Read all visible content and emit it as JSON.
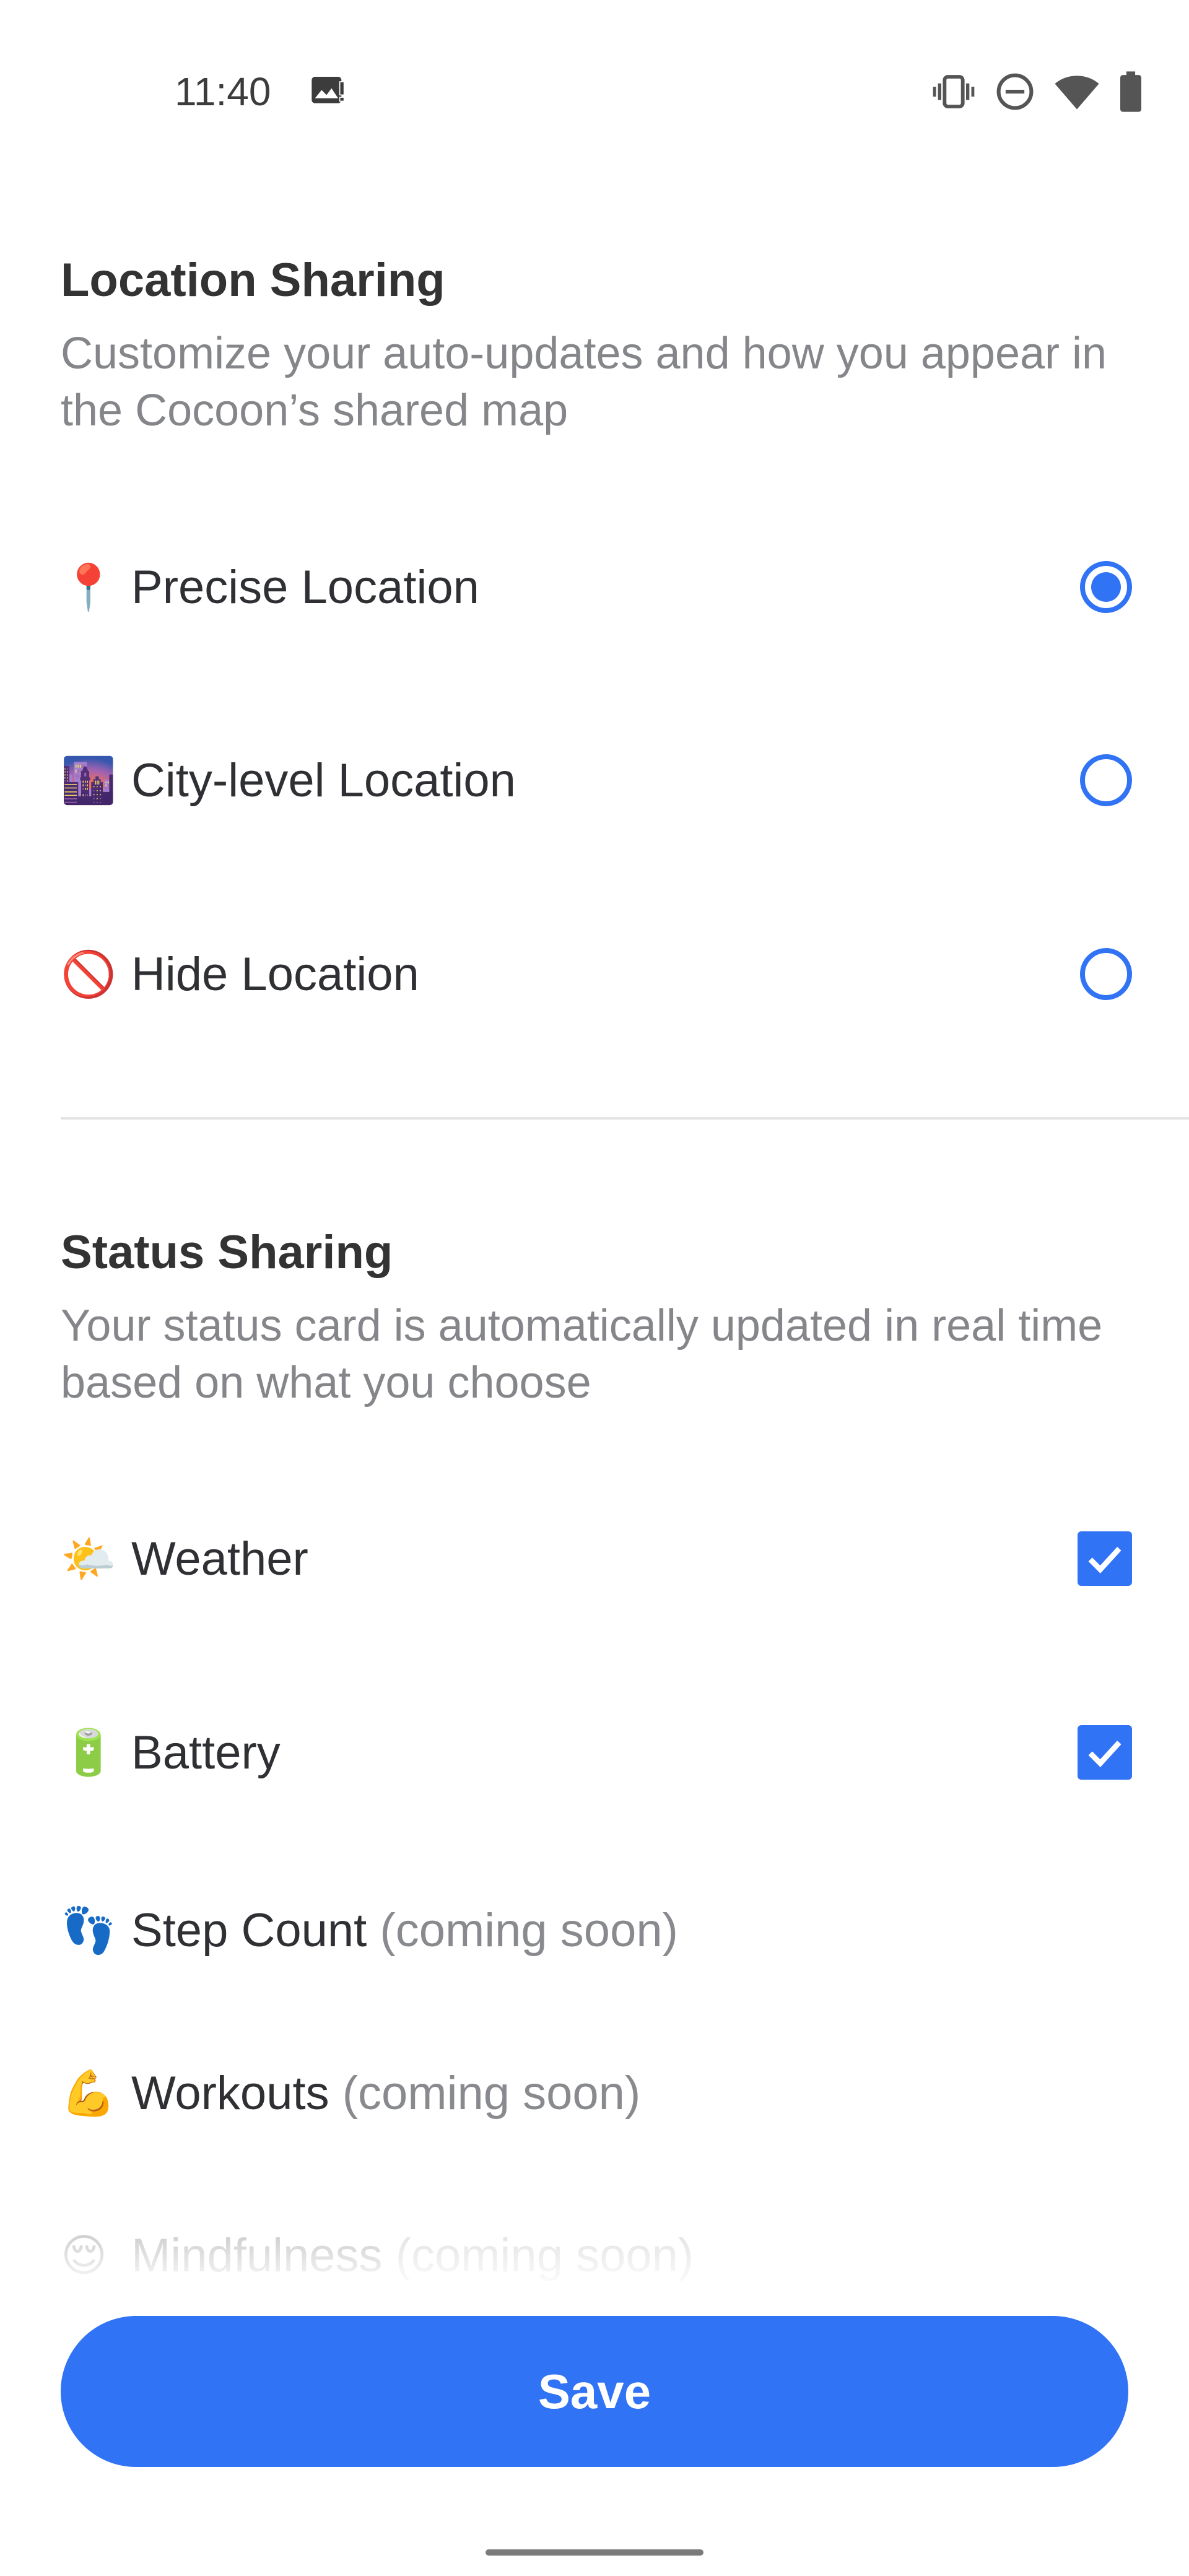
{
  "status_bar": {
    "time": "11:40",
    "icons": [
      "image-notification-icon",
      "vibrate-icon",
      "do-not-disturb-icon",
      "wifi-icon",
      "battery-icon"
    ]
  },
  "location_section": {
    "title": "Location Sharing",
    "description": "Customize your auto-updates and how you appear in the Cocoon’s shared map",
    "options": [
      {
        "emoji": "📍",
        "icon": "round-pushpin-icon",
        "label": "Precise Location",
        "selected": true
      },
      {
        "emoji": "🌆",
        "icon": "cityscape-icon",
        "label": "City-level Location",
        "selected": false
      },
      {
        "emoji": "🚫",
        "icon": "prohibited-icon",
        "label": "Hide Location",
        "selected": false
      }
    ]
  },
  "status_section": {
    "title": "Status Sharing",
    "description": "Your status card is automatically updated in real time based on what you choose",
    "items": [
      {
        "emoji": "🌤️",
        "icon": "sun-behind-cloud-icon",
        "label": "Weather",
        "checked": true
      },
      {
        "emoji": "🔋",
        "icon": "battery-emoji-icon",
        "label": "Battery",
        "checked": true
      },
      {
        "emoji": "👣",
        "icon": "footprints-icon",
        "label": "Step Count",
        "note": "(coming soon)"
      },
      {
        "emoji": "💪",
        "icon": "flexed-biceps-icon",
        "label": "Workouts",
        "note": "(coming soon)"
      },
      {
        "emoji": "😌",
        "icon": "relieved-face-icon",
        "label": "Mindfulness",
        "note": "(coming soon)"
      }
    ]
  },
  "save_button": {
    "label": "Save"
  },
  "colors": {
    "accent": "#3173f5",
    "title_text": "#333333",
    "secondary_text": "#85868a",
    "divider": "#e4e4e6"
  }
}
